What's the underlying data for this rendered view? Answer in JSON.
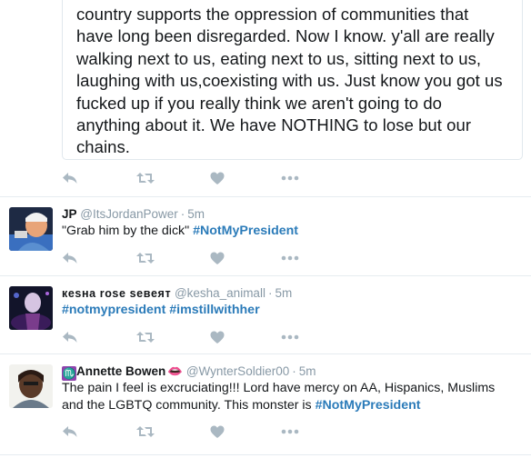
{
  "top_tweet": {
    "quote_text": "country supports the oppression of communities that have long been disregarded. Now I know. y'all are really walking next to us, eating next to us, sitting next to us, laughing with us,coexisting with us. Just know you got us fucked up if you really think we aren't going to do anything about it. We have NOTHING to lose but our chains."
  },
  "tweets": [
    {
      "name": "JP",
      "handle": "@ItsJordanPower",
      "time": "5m",
      "text_plain": "\"Grab him by the dick\" ",
      "hashtags": [
        "#NotMyPresident"
      ],
      "avatar_colors": [
        "#1e2a44",
        "#f0b48a",
        "#5a8fd0"
      ]
    },
    {
      "name": "кesнa rose seвeят",
      "handle": "@kesha_animall",
      "time": "5m",
      "hashtags": [
        "#notmypresident",
        "#imstillwithher"
      ],
      "avatar_colors": [
        "#12142a",
        "#c8b4d8",
        "#7a3c8c"
      ]
    },
    {
      "name_prefix": "♏",
      "name": "Annette Bowen",
      "name_suffix": "👄",
      "handle": "@WynterSoldier00",
      "time": "5m",
      "text_plain": "The pain I feel is excruciating!!! Lord have mercy on AA, Hispanics, Muslims and the LGBTQ community. This monster is ",
      "hashtags": [
        "#NotMyPresident"
      ],
      "avatar_colors": [
        "#f2f2ee",
        "#5a3a28",
        "#2a1a14"
      ]
    }
  ],
  "separator": "·",
  "icons": [
    "reply-icon",
    "retweet-icon",
    "like-icon",
    "more-icon"
  ],
  "colors": {
    "icon": "#aab8c2",
    "hashtag": "#2b7bb9",
    "meta": "#8899a6",
    "divider": "#e6ecf0"
  }
}
